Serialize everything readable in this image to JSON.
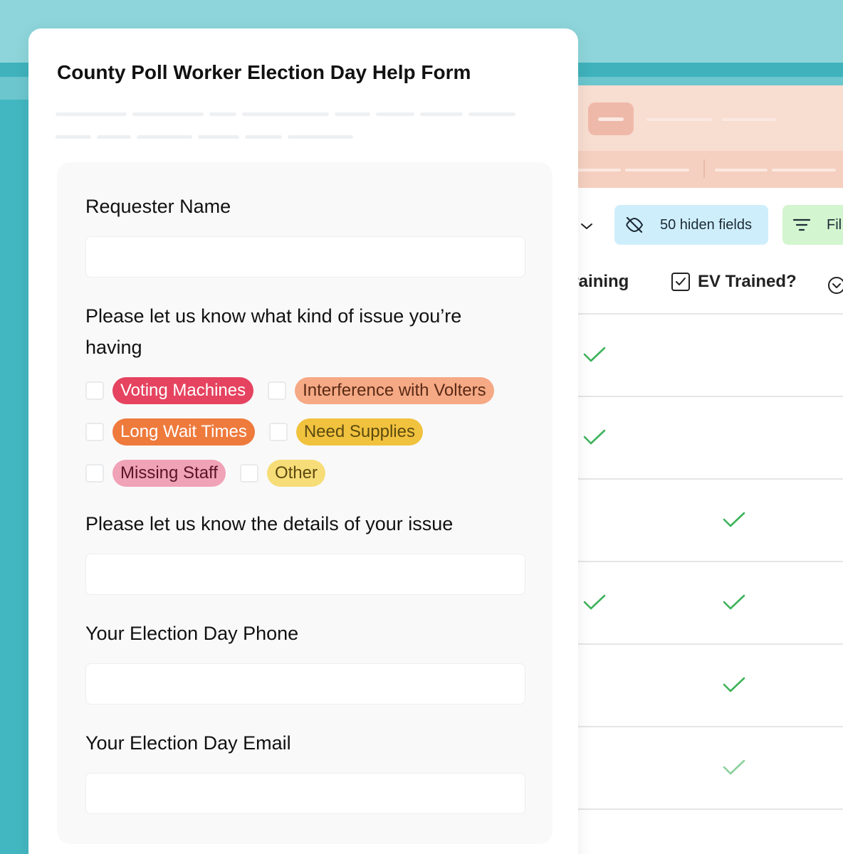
{
  "form": {
    "title": "County Poll Worker Election Day Help Form",
    "fields": [
      {
        "label": "Requester Name",
        "value": ""
      },
      {
        "label": "Please let us know what kind of issue you’re having"
      },
      {
        "label": "Please let us know the details of your issue",
        "value": ""
      },
      {
        "label": "Your Election Day Phone",
        "value": ""
      },
      {
        "label": "Your Election Day Email",
        "value": ""
      }
    ],
    "options": [
      {
        "label": "Voting Machines",
        "bg": "#e5435f",
        "fg": "#ffffff"
      },
      {
        "label": "Interference with Volters",
        "bg": "#f5a985",
        "fg": "#5a2a15"
      },
      {
        "label": "Long Wait Times",
        "bg": "#ee7a3c",
        "fg": "#ffffff"
      },
      {
        "label": "Need Supplies",
        "bg": "#f1c23e",
        "fg": "#5c4a10"
      },
      {
        "label": "Missing Staff",
        "bg": "#f0a2b6",
        "fg": "#5a1426"
      },
      {
        "label": "Other",
        "bg": "#f7dd78",
        "fg": "#5c4a10"
      }
    ]
  },
  "app": {
    "hidden_fields_label": "50 hiden fields",
    "filter_label": "Fil",
    "columns": [
      {
        "label": "Training"
      },
      {
        "label": "EV Trained?"
      }
    ],
    "rows": [
      {
        "training": true,
        "ev_trained": false
      },
      {
        "training": true,
        "ev_trained": false
      },
      {
        "training": false,
        "ev_trained": true
      },
      {
        "training": true,
        "ev_trained": true
      },
      {
        "training": false,
        "ev_trained": true
      },
      {
        "training": false,
        "ev_trained": true
      }
    ]
  },
  "colors": {
    "teal": "#43b7c1",
    "check_green": "#3db35a",
    "header_peach": "#f8ddd1"
  }
}
